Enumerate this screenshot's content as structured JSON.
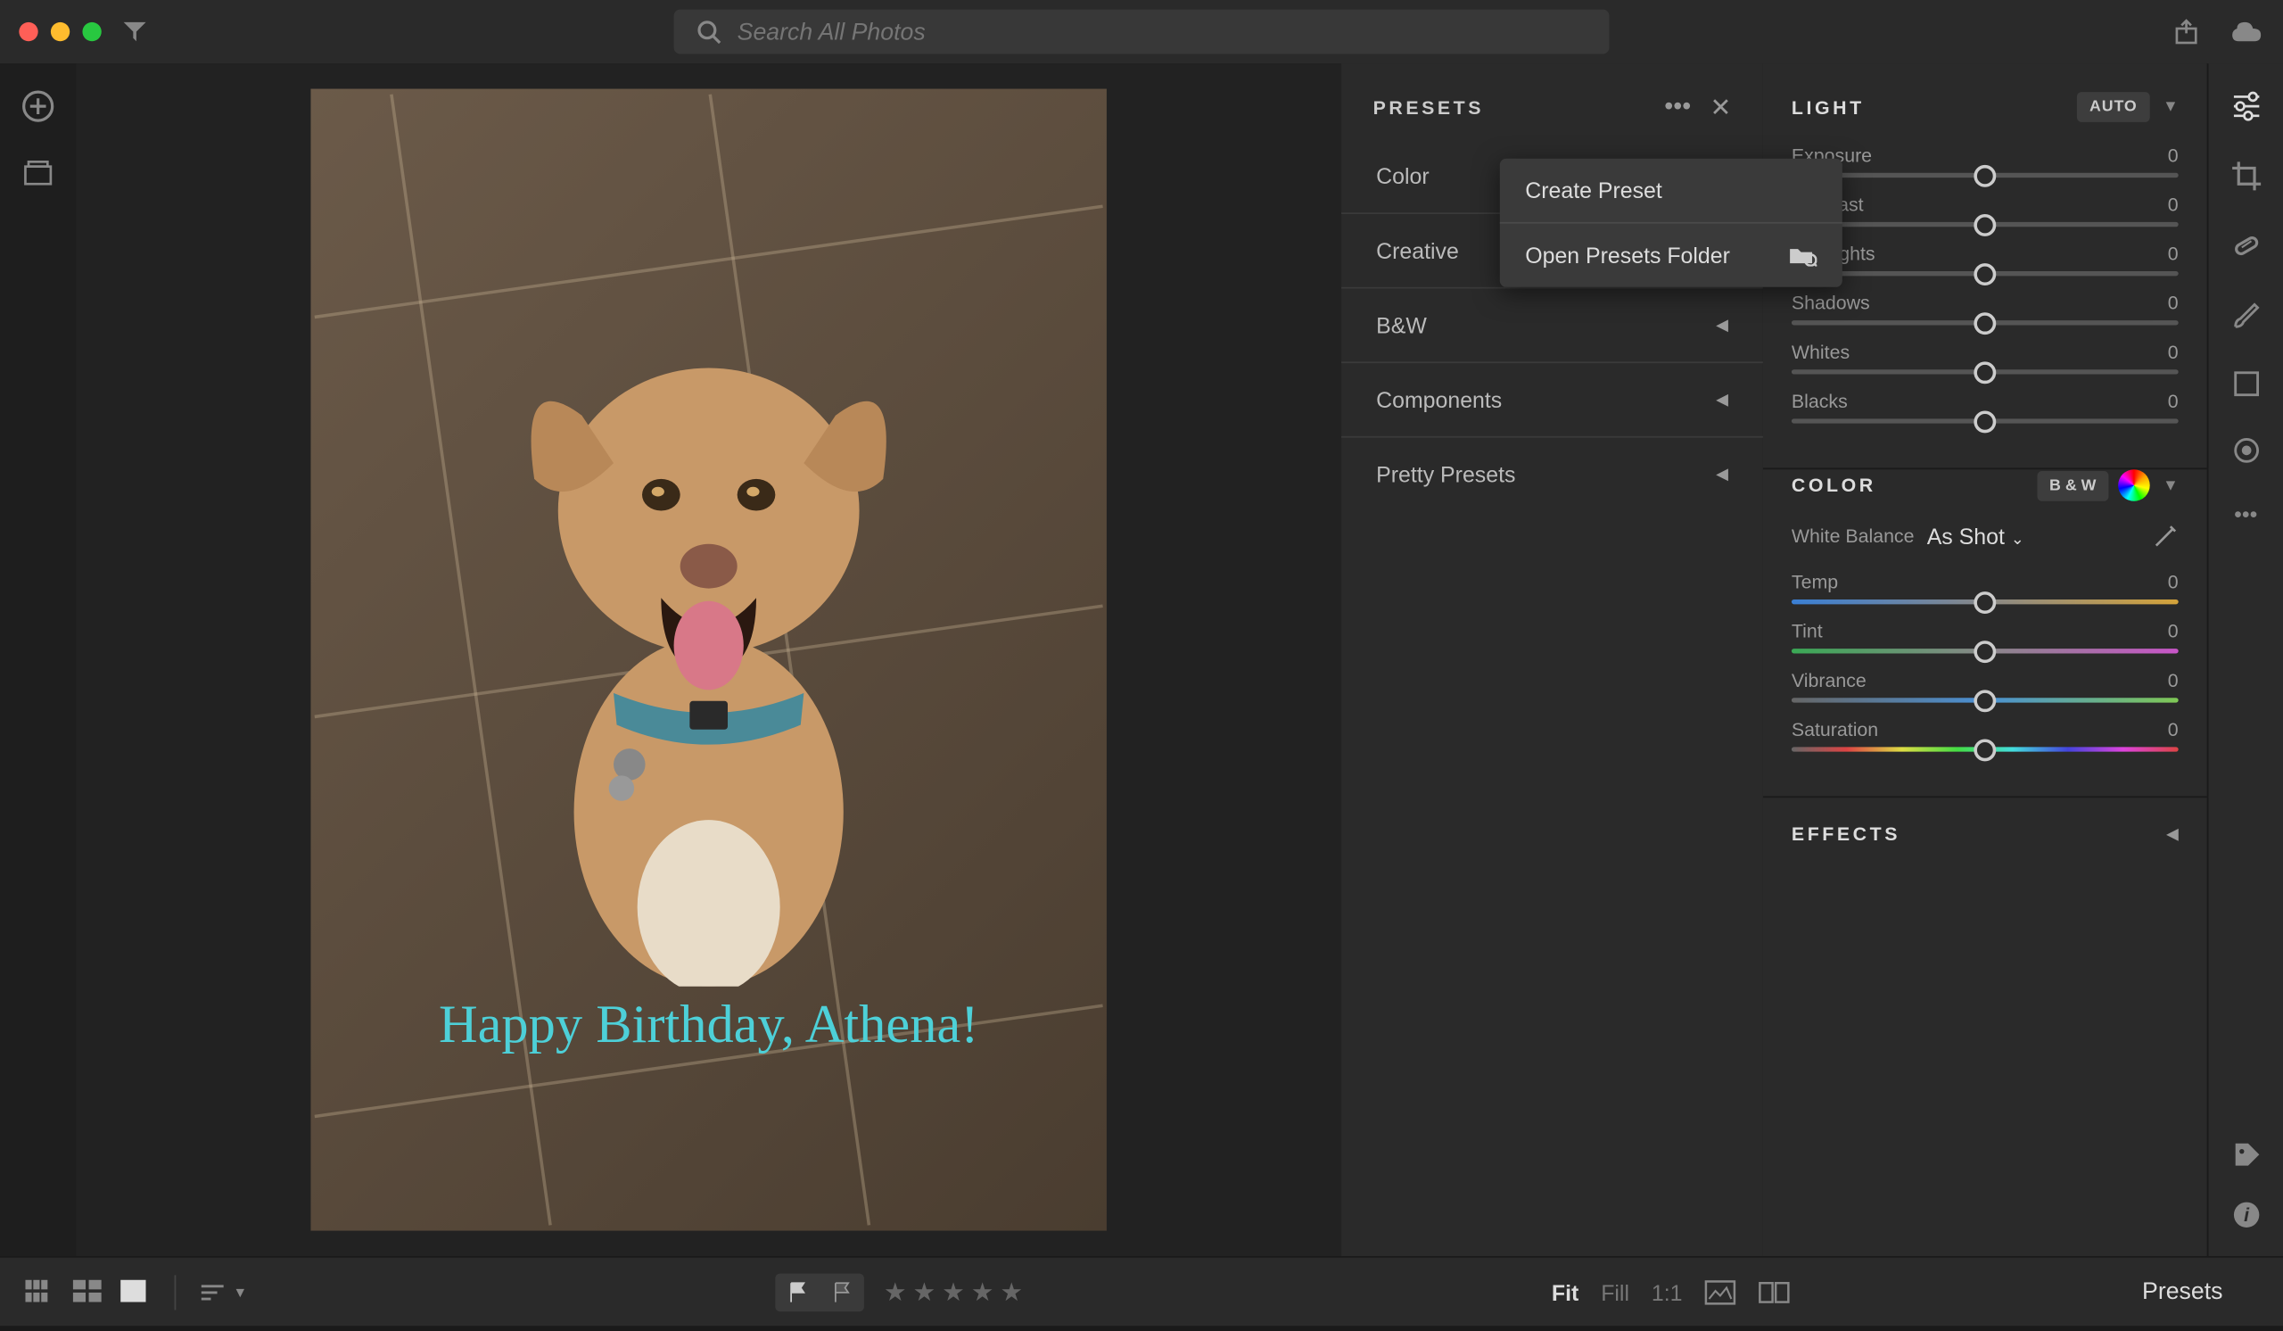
{
  "search": {
    "placeholder": "Search All Photos"
  },
  "presets_panel": {
    "title": "PRESETS",
    "items": [
      "Color",
      "Creative",
      "B&W",
      "Components",
      "Pretty Presets"
    ]
  },
  "context_menu": {
    "create": "Create Preset",
    "open": "Open Presets Folder"
  },
  "photo_overlay": "Happy Birthday, Athena!",
  "light": {
    "title": "LIGHT",
    "auto": "AUTO",
    "sliders": [
      {
        "label": "Exposure",
        "value": "0"
      },
      {
        "label": "Contrast",
        "value": "0"
      },
      {
        "label": "Highlights",
        "value": "0"
      },
      {
        "label": "Shadows",
        "value": "0"
      },
      {
        "label": "Whites",
        "value": "0"
      },
      {
        "label": "Blacks",
        "value": "0"
      }
    ]
  },
  "color": {
    "title": "COLOR",
    "bw": "B & W",
    "wb_label": "White Balance",
    "wb_value": "As Shot",
    "sliders": [
      {
        "label": "Temp",
        "value": "0",
        "cls": "temp"
      },
      {
        "label": "Tint",
        "value": "0",
        "cls": "tint"
      },
      {
        "label": "Vibrance",
        "value": "0",
        "cls": "vib"
      },
      {
        "label": "Saturation",
        "value": "0",
        "cls": "sat"
      }
    ]
  },
  "effects": {
    "title": "EFFECTS"
  },
  "bottombar": {
    "fit": "Fit",
    "fill": "Fill",
    "oneone": "1:1",
    "presets": "Presets"
  }
}
